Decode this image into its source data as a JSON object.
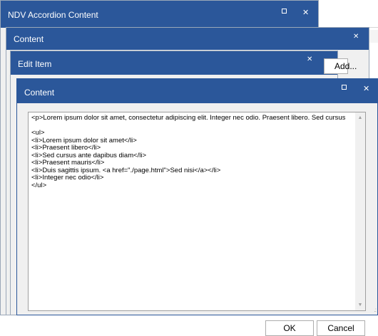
{
  "windows": {
    "accordion": {
      "title": "NDV Accordion Content"
    },
    "content_back": {
      "title": "Content"
    },
    "edit_item": {
      "title": "Edit Item",
      "add_label": "Add..."
    },
    "content_front": {
      "title": "Content",
      "editor_text": "<p>Lorem ipsum dolor sit amet, consectetur adipiscing elit. Integer nec odio. Praesent libero. Sed cursus\n\n<ul>\n<li>Lorem ipsum dolor sit amet</li>\n<li>Praesent libero</li>\n<li>Sed cursus ante dapibus diam</li>\n<li>Praesent mauris</li>\n<li>Duis sagittis ipsum. <a href=\"./page.html\">Sed nisi</a></li>\n<li>Integer nec odio</li>\n</ul>",
      "ok_label": "OK",
      "cancel_label": "Cancel"
    }
  },
  "glyphs": {
    "close": "✕",
    "scroll_up": "▲",
    "scroll_down": "▼",
    "grip": ".:"
  },
  "colors": {
    "titlebar": "#2b579a",
    "window_bg": "#f0f0f0"
  }
}
